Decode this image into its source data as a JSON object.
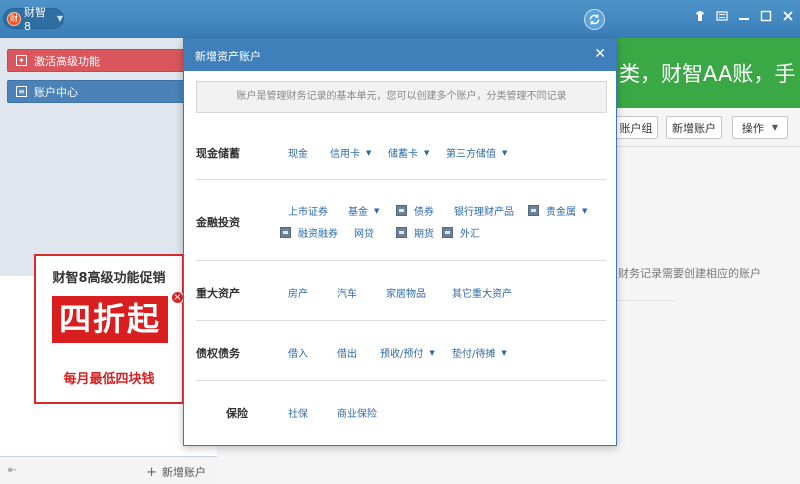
{
  "app": {
    "name": "财智8",
    "logo_char": "财"
  },
  "window_controls": {
    "close_glyph": "✕",
    "minimize_glyph": "—",
    "maximize_glyph": "☐"
  },
  "sidebar": {
    "items": [
      {
        "label": "激活高级功能",
        "icon": "activate-icon",
        "color": "#d9575c"
      },
      {
        "label": "账户中心",
        "icon": "account-center-icon",
        "color": "#4b82b7"
      }
    ],
    "promo": {
      "title": "财智8高级功能促销",
      "big": "四折起",
      "sub": "每月最低四块钱"
    },
    "add_account": "新增账户"
  },
  "main": {
    "banner_text": "类，财智AA账，手",
    "toolbar": {
      "group": "账户组",
      "new_account": "新增账户",
      "operate": "操作"
    },
    "empty_hint": "财务记录需要创建相应的账户"
  },
  "modal": {
    "title": "新增资产账户",
    "intro": "账户是管理财务记录的基本单元，您可以创建多个账户，分类管理不同记录",
    "sections": [
      {
        "label": "现金储蓄",
        "options": [
          "现金",
          "信用卡",
          "储蓄卡",
          "第三方储值"
        ]
      },
      {
        "label": "金融投资",
        "options": [
          "上市证券",
          "基金",
          "债券",
          "银行理财产品",
          "贵金属",
          "融资融券",
          "网贷",
          "期货",
          "外汇"
        ]
      },
      {
        "label": "重大资产",
        "options": [
          "房产",
          "汽车",
          "家居物品",
          "其它重大资产"
        ]
      },
      {
        "label": "债权债务",
        "options": [
          "借入",
          "借出",
          "预收/预付",
          "垫付/待摊"
        ]
      },
      {
        "label": "保险",
        "options": [
          "社保",
          "商业保险"
        ]
      }
    ]
  },
  "colors": {
    "title_bar": "#3a7db8",
    "modal_header": "#3f7fba",
    "link": "#2c6aa8",
    "banner": "#3aa845",
    "promo_red": "#d81e1e"
  }
}
